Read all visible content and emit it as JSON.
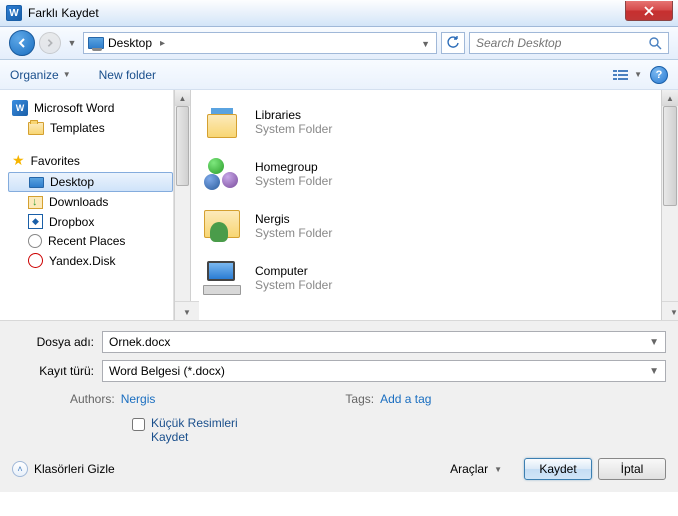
{
  "window": {
    "title": "Farklı Kaydet"
  },
  "address": {
    "current": "Desktop",
    "search_placeholder": "Search Desktop"
  },
  "toolbar": {
    "organize": "Organize",
    "new_folder": "New folder"
  },
  "sidebar": {
    "word_root": "Microsoft Word",
    "templates": "Templates",
    "favorites_label": "Favorites",
    "items": [
      {
        "label": "Desktop"
      },
      {
        "label": "Downloads"
      },
      {
        "label": "Dropbox"
      },
      {
        "label": "Recent Places"
      },
      {
        "label": "Yandex.Disk"
      }
    ]
  },
  "content": {
    "folder_type": "System Folder",
    "items": [
      {
        "name": "Libraries"
      },
      {
        "name": "Homegroup"
      },
      {
        "name": "Nergis"
      },
      {
        "name": "Computer"
      }
    ]
  },
  "form": {
    "filename_label": "Dosya adı:",
    "filename_value": "Ornek.docx",
    "type_label": "Kayıt türü:",
    "type_value": "Word Belgesi (*.docx)",
    "authors_label": "Authors:",
    "authors_value": "Nergis",
    "tags_label": "Tags:",
    "tags_value": "Add a tag",
    "thumbnail_label": "Küçük Resimleri Kaydet"
  },
  "footer": {
    "hide_folders": "Klasörleri Gizle",
    "tools": "Araçlar",
    "save": "Kaydet",
    "cancel": "İptal"
  }
}
